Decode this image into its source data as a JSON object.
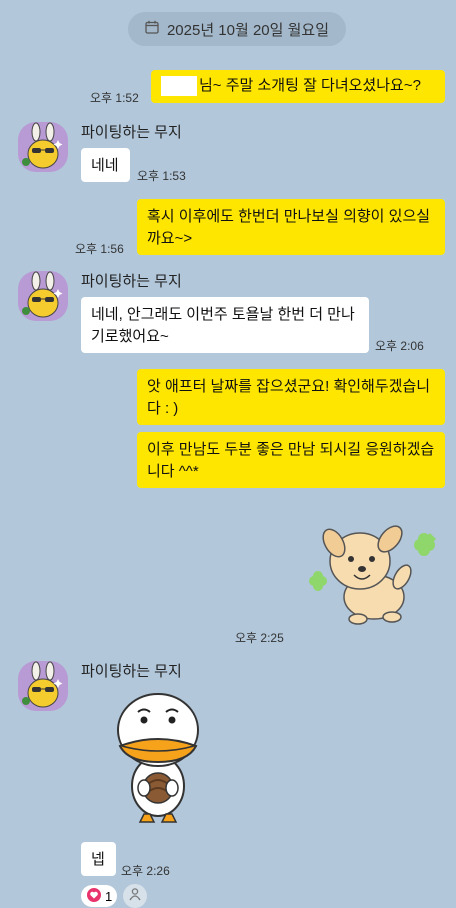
{
  "date": {
    "label": "2025년 10월 20일 월요일"
  },
  "sender_name": "파이팅하는 무지",
  "messages": [
    {
      "text": "님~ 주말 소개팅 잘 다녀오셨나요~?",
      "time": "오후 1:52"
    },
    {
      "text": "네네",
      "time": "오후 1:53"
    },
    {
      "text": "혹시 이후에도 한번더 만나보실 의향이 있으실까요~>",
      "time": "오후 1:56"
    },
    {
      "text": "네네, 안그래도 이번주 토욜날 한번 더 만나기로했어요~",
      "time": "오후 2:06"
    },
    {
      "text": "앗 애프터 날짜를 잡으셨군요! 확인해두겠습니다 : )",
      "time": ""
    },
    {
      "text": "이후 만남도 두분 좋은 만남 되시길 응원하겠습니다 ^^*",
      "time": "오후 2:25"
    },
    {
      "text": "넵",
      "time": "오후 2:26"
    }
  ],
  "reaction": {
    "count": "1"
  },
  "icons": [
    "calendar-icon",
    "heart-icon",
    "person-icon"
  ],
  "colors": {
    "background": "#b2c7da",
    "my_bubble": "#ffe600",
    "their_bubble": "#ffffff",
    "reaction_heart": "#e8336d"
  }
}
